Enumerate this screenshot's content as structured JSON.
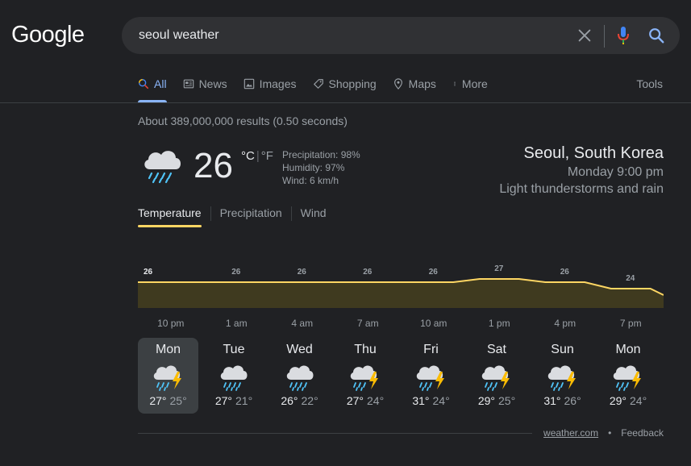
{
  "logo": "Google",
  "search": {
    "query": "seoul weather"
  },
  "tabs": [
    {
      "label": "All",
      "icon": "search-icon",
      "active": true
    },
    {
      "label": "News",
      "icon": "news-icon"
    },
    {
      "label": "Images",
      "icon": "image-icon"
    },
    {
      "label": "Shopping",
      "icon": "tag-icon"
    },
    {
      "label": "Maps",
      "icon": "map-pin-icon"
    },
    {
      "label": "More",
      "icon": "more-vert-icon"
    }
  ],
  "tools_label": "Tools",
  "results_count": "About 389,000,000 results (0.50 seconds)",
  "weather": {
    "temp": "26",
    "unit_c": "°C",
    "unit_sep": "|",
    "unit_f": "°F",
    "precipitation": "Precipitation: 98%",
    "humidity": "Humidity: 97%",
    "wind": "Wind: 6 km/h",
    "location": "Seoul, South Korea",
    "time": "Monday 9:00 pm",
    "condition": "Light thunderstorms and rain",
    "icon": "rain-cloud-icon"
  },
  "subtabs": [
    "Temperature",
    "Precipitation",
    "Wind"
  ],
  "chart_data": {
    "type": "area",
    "x": [
      "10 pm",
      "1 am",
      "4 am",
      "7 am",
      "10 am",
      "1 pm",
      "4 pm",
      "7 pm"
    ],
    "values": [
      26,
      26,
      26,
      26,
      26,
      27,
      26,
      24
    ],
    "x_labels": [
      "10 pm",
      "1 am",
      "4 am",
      "7 am",
      "10 am",
      "1 pm",
      "4 pm",
      "7 pm"
    ],
    "data_labels": [
      "26",
      "26",
      "26",
      "26",
      "26",
      "27",
      "26",
      "24"
    ],
    "line_color": "#fdd663",
    "fill_color": "#3f3a1f"
  },
  "forecast": [
    {
      "day": "Mon",
      "hi": "27°",
      "lo": "25°",
      "icon": "thunderstorm-icon",
      "selected": true
    },
    {
      "day": "Tue",
      "hi": "27°",
      "lo": "21°",
      "icon": "rain-cloud-icon"
    },
    {
      "day": "Wed",
      "hi": "26°",
      "lo": "22°",
      "icon": "rain-cloud-icon"
    },
    {
      "day": "Thu",
      "hi": "27°",
      "lo": "24°",
      "icon": "thunderstorm-icon"
    },
    {
      "day": "Fri",
      "hi": "31°",
      "lo": "24°",
      "icon": "thunderstorm-icon"
    },
    {
      "day": "Sat",
      "hi": "29°",
      "lo": "25°",
      "icon": "thunderstorm-icon"
    },
    {
      "day": "Sun",
      "hi": "31°",
      "lo": "26°",
      "icon": "thunderstorm-icon"
    },
    {
      "day": "Mon",
      "hi": "29°",
      "lo": "24°",
      "icon": "thunderstorm-icon"
    }
  ],
  "footer": {
    "source": "weather.com",
    "separator": "•",
    "feedback": "Feedback"
  },
  "colors": {
    "accent": "#8ab4f8",
    "chart_line": "#fdd663",
    "background": "#202124"
  }
}
